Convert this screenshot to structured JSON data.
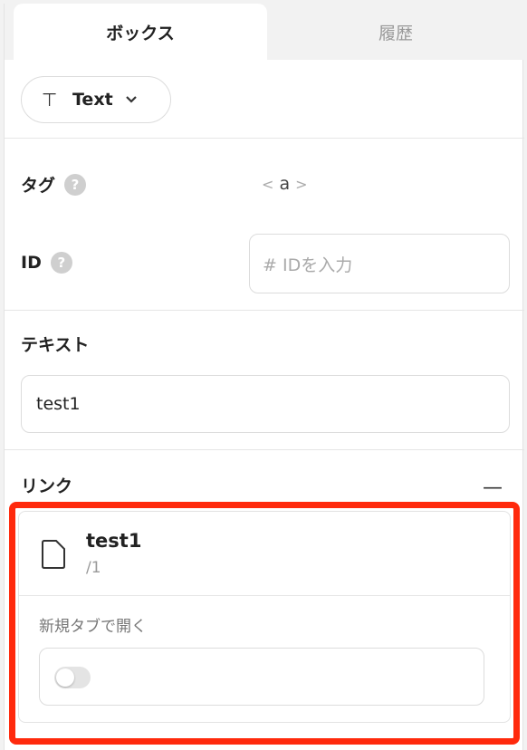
{
  "tabs": [
    {
      "label": "ボックス",
      "active": true
    },
    {
      "label": "履歴",
      "active": false
    }
  ],
  "element_type": {
    "icon": "text-cursor-icon",
    "label": "Text"
  },
  "tag": {
    "label": "タグ",
    "value": "a",
    "bracket_open": "<",
    "bracket_close": ">"
  },
  "id": {
    "label": "ID",
    "placeholder": "# IDを入力"
  },
  "text": {
    "label": "テキスト",
    "value": "test1"
  },
  "link": {
    "label": "リンク",
    "collapse_symbol": "—",
    "page_name": "test1",
    "page_path": "/1",
    "new_tab_label": "新規タブで開く",
    "new_tab_enabled": false
  },
  "help_symbol": "?",
  "colors": {
    "highlight": "#ff2a0d",
    "tab_inactive_bg": "#f2f2f2"
  }
}
